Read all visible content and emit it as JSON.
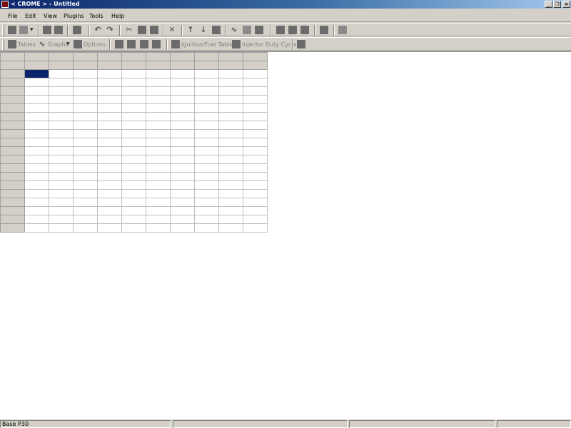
{
  "window": {
    "title": "< CROME > - Untitled"
  },
  "menu": [
    "File",
    "Edit",
    "View",
    "Plugins",
    "Tools",
    "Help"
  ],
  "toolbar2": {
    "tables_label": "Tables",
    "graphs_label": "Graphs",
    "options_label": "Options",
    "ignition_fuel_label": "Ignition/Fuel Tables",
    "injector_duty_label": "Injector Duty Cycle"
  },
  "grid": {
    "columns": 10,
    "header_rows": 2,
    "body_rows": 19,
    "selected_cell": {
      "row": 0,
      "col": 0
    }
  },
  "status": {
    "rom_base": "Base P30"
  },
  "colors": {
    "selection": "#0a246a",
    "titlebar": "#0a246a",
    "chrome": "#d4d0c8"
  }
}
